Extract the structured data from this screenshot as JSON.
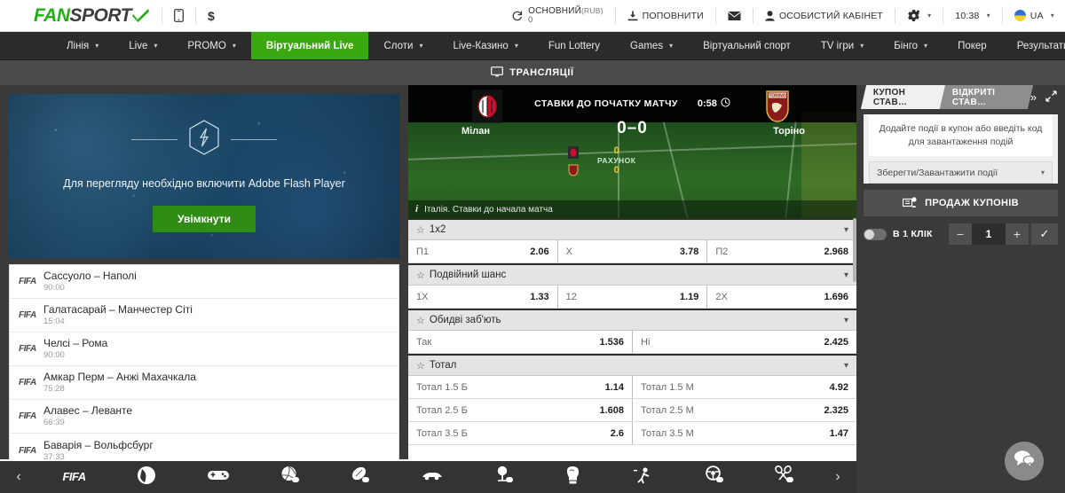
{
  "topbar": {
    "logo": {
      "part1": "FAN",
      "part2": "SPORT",
      "swoosh": "✓"
    },
    "mobile_icon": "mobile-phone-icon",
    "currency_icon": "dollar-icon",
    "currency_symbol": "$",
    "balance": {
      "refresh_icon": "refresh-icon",
      "name": "ОСНОВНИЙ",
      "currency": "(RUB)",
      "value": "0"
    },
    "deposit": {
      "icon": "download-icon",
      "label": "ПОПОВНИТИ"
    },
    "mail_icon": "envelope-icon",
    "account": {
      "icon": "user-icon",
      "label": "ОСОБИСТИЙ КАБІНЕТ"
    },
    "settings_icon": "gear-icon",
    "time": "10:38",
    "language": "UA"
  },
  "nav": {
    "items": [
      {
        "label": "Лінія",
        "caret": true,
        "active": false
      },
      {
        "label": "Live",
        "caret": true,
        "active": false
      },
      {
        "label": "PROMO",
        "caret": true,
        "active": false
      },
      {
        "label": "Віртуальний Live",
        "caret": false,
        "active": true
      },
      {
        "label": "Слоти",
        "caret": true,
        "active": false
      },
      {
        "label": "Live-Казино",
        "caret": true,
        "active": false
      },
      {
        "label": "Fun Lottery",
        "caret": false,
        "active": false
      },
      {
        "label": "Games",
        "caret": true,
        "active": false
      },
      {
        "label": "Віртуальний спорт",
        "caret": false,
        "active": false
      },
      {
        "label": "TV ігри",
        "caret": true,
        "active": false
      },
      {
        "label": "Бінго",
        "caret": true,
        "active": false
      },
      {
        "label": "Покер",
        "caret": false,
        "active": false
      },
      {
        "label": "Результати",
        "caret": true,
        "active": false
      }
    ]
  },
  "subheader": {
    "icon": "monitor-icon",
    "label": "ТРАНСЛЯЦІЇ"
  },
  "flash_panel": {
    "icon": "flash-player-icon",
    "message": "Для перегляду необхідно включити Adobe Flash Player",
    "button_label": "Увімкнути"
  },
  "match_list": {
    "items": [
      {
        "badge": "FIFA",
        "teams": "Сассуоло – Наполі",
        "time": "90:00"
      },
      {
        "badge": "FIFA",
        "teams": "Галатасарай – Манчестер Сіті",
        "time": "15:04"
      },
      {
        "badge": "FIFA",
        "teams": "Челсі – Рома",
        "time": "90:00"
      },
      {
        "badge": "FIFA",
        "teams": "Амкар Перм – Анжі Махачкала",
        "time": "75:28"
      },
      {
        "badge": "FIFA",
        "teams": "Алавес – Леванте",
        "time": "66:39"
      },
      {
        "badge": "FIFA",
        "teams": "Баварія – Вольфсбург",
        "time": "37:33"
      }
    ]
  },
  "match": {
    "status": "СТАВКИ ДО ПОЧАТКУ МАТЧУ",
    "timer": "0:58",
    "timer_icon": "clock-icon",
    "score": "0–0",
    "home_team": "Мілан",
    "away_team": "Торіно",
    "home_crest": "ac-milan-crest",
    "away_crest": "torino-crest",
    "overlay": {
      "label": "РАХУНОК",
      "home_value": "0",
      "away_value": "0"
    },
    "info_icon": "info-icon",
    "info": "Італія. Ставки до начала матча"
  },
  "markets": [
    {
      "title": "1x2",
      "star_icon": "star-icon",
      "chevron_icon": "chevron-down-icon",
      "rows": [
        [
          {
            "label": "П1",
            "odd": "2.06"
          },
          {
            "label": "X",
            "odd": "3.78"
          },
          {
            "label": "П2",
            "odd": "2.968"
          }
        ]
      ]
    },
    {
      "title": "Подвійний шанс",
      "star_icon": "star-icon",
      "chevron_icon": "chevron-down-icon",
      "rows": [
        [
          {
            "label": "1X",
            "odd": "1.33"
          },
          {
            "label": "12",
            "odd": "1.19"
          },
          {
            "label": "2X",
            "odd": "1.696"
          }
        ]
      ]
    },
    {
      "title": "Обидві заб'ють",
      "star_icon": "star-icon",
      "chevron_icon": "chevron-down-icon",
      "rows": [
        [
          {
            "label": "Так",
            "odd": "1.536"
          },
          {
            "label": "Ні",
            "odd": "2.425"
          }
        ]
      ]
    },
    {
      "title": "Тотал",
      "star_icon": "star-icon",
      "chevron_icon": "chevron-down-icon",
      "rows": [
        [
          {
            "label": "Тотал 1.5 Б",
            "odd": "1.14"
          },
          {
            "label": "Тотал 1.5 М",
            "odd": "4.92"
          }
        ],
        [
          {
            "label": "Тотал 2.5 Б",
            "odd": "1.608"
          },
          {
            "label": "Тотал 2.5 М",
            "odd": "2.325"
          }
        ],
        [
          {
            "label": "Тотал 3.5 Б",
            "odd": "2.6"
          },
          {
            "label": "Тотал 3.5 М",
            "odd": "1.47"
          }
        ]
      ]
    }
  ],
  "coupon": {
    "tab_active": "КУПОН СТАВ…",
    "tab_inactive": "ВІДКРИТІ СТАВ…",
    "collapse_icon": "double-chevron-right-icon",
    "expand_icon": "expand-icon",
    "empty_message": "Додайте події в купон або введіть код для завантаження подій",
    "load_select": "Зберегти/Завантажити події",
    "load_select_chevron": "chevron-down-icon",
    "sale_icon": "coupon-sale-icon",
    "sale_label": "ПРОДАЖ КУПОНІВ",
    "one_click_label": "В 1 КЛІК",
    "stepper": {
      "minus": "−",
      "value": "1",
      "plus": "+",
      "confirm": "✓"
    }
  },
  "bottom_bar": {
    "prev_icon": "chevron-left-icon",
    "next_icon": "chevron-right-icon",
    "items": [
      {
        "icon": "fifa-icon",
        "label": "FIFA"
      },
      {
        "icon": "nba-icon",
        "label": ""
      },
      {
        "icon": "gamepad-icon",
        "label": ""
      },
      {
        "icon": "volleyball-icon",
        "label": ""
      },
      {
        "icon": "rugby-icon",
        "label": ""
      },
      {
        "icon": "racing-car-icon",
        "label": ""
      },
      {
        "icon": "golf-icon",
        "label": ""
      },
      {
        "icon": "boxing-glove-icon",
        "label": ""
      },
      {
        "icon": "shooter-icon",
        "label": ""
      },
      {
        "icon": "steering-wheel-icon",
        "label": ""
      },
      {
        "icon": "tennis-rackets-icon",
        "label": ""
      }
    ]
  },
  "chat_button": {
    "icon": "chat-bubbles-icon"
  },
  "colors": {
    "brand_green": "#22b014",
    "nav_active": "#3aa80f",
    "odds_text": "#1d1d1d"
  }
}
